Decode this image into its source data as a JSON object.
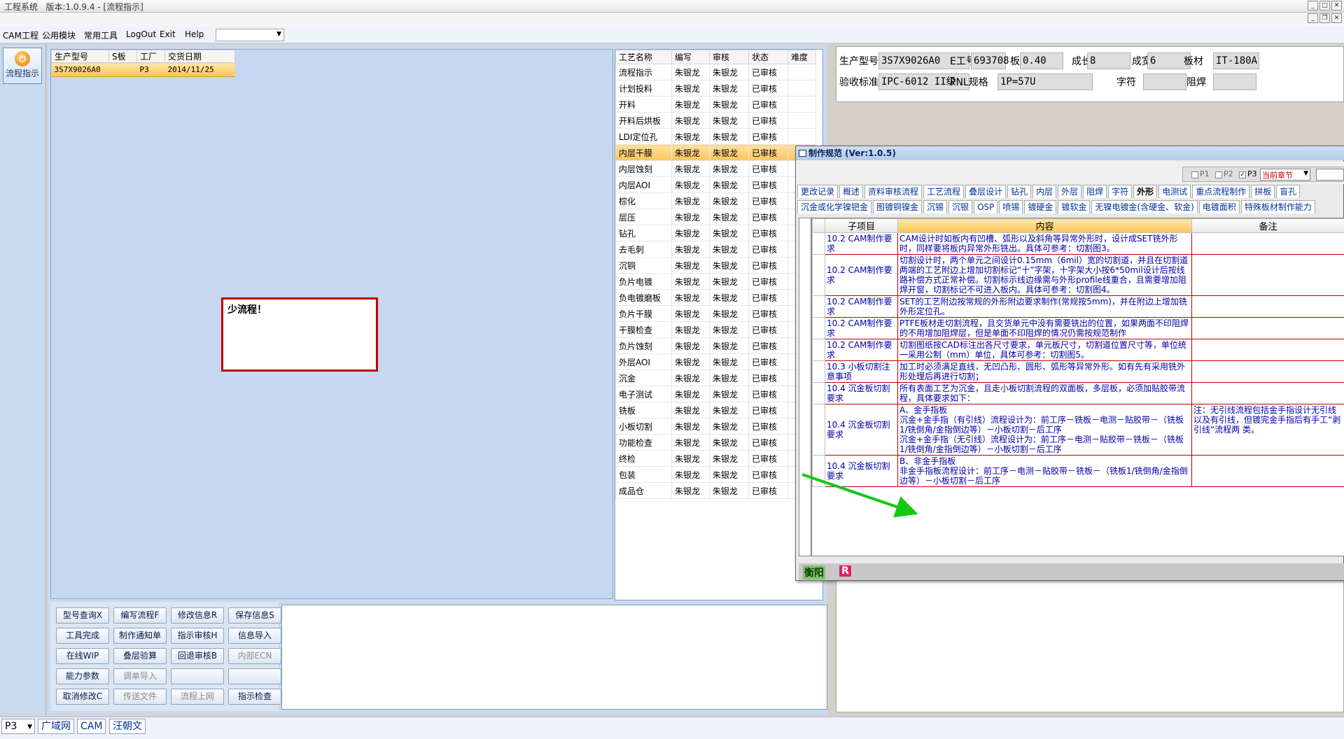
{
  "app": {
    "title": "工程系统   版本:1.0.9.4 - [流程指示]"
  },
  "menu": [
    "CAM工程",
    "公用模块",
    "常用工具",
    "LogOut",
    "Exit",
    "Help"
  ],
  "left": {
    "flow_label": "流程指示"
  },
  "prod": {
    "headers": [
      "生产型号",
      "S板",
      "工厂",
      "交货日期"
    ],
    "row": [
      "3S7X9026A0",
      "",
      "P3",
      "2014/11/25"
    ]
  },
  "message": "少流程！",
  "steps": {
    "headers": [
      "工艺名称",
      "编写",
      "审核",
      "状态",
      "难度"
    ],
    "rows": [
      [
        "流程指示",
        "朱银龙",
        "朱银龙",
        "已审核"
      ],
      [
        "计划投料",
        "朱银龙",
        "朱银龙",
        "已审核"
      ],
      [
        "开料",
        "朱银龙",
        "朱银龙",
        "已审核"
      ],
      [
        "开料后烘板",
        "朱银龙",
        "朱银龙",
        "已审核"
      ],
      [
        "LDI定位孔",
        "朱银龙",
        "朱银龙",
        "已审核"
      ],
      [
        "内层干膜",
        "朱银龙",
        "朱银龙",
        "已审核"
      ],
      [
        "内层蚀刻",
        "朱银龙",
        "朱银龙",
        "已审核"
      ],
      [
        "内层AOI",
        "朱银龙",
        "朱银龙",
        "已审核"
      ],
      [
        "棕化",
        "朱银龙",
        "朱银龙",
        "已审核"
      ],
      [
        "层压",
        "朱银龙",
        "朱银龙",
        "已审核"
      ],
      [
        "钻孔",
        "朱银龙",
        "朱银龙",
        "已审核"
      ],
      [
        "去毛刺",
        "朱银龙",
        "朱银龙",
        "已审核"
      ],
      [
        "沉铜",
        "朱银龙",
        "朱银龙",
        "已审核"
      ],
      [
        "负片电镀",
        "朱银龙",
        "朱银龙",
        "已审核"
      ],
      [
        "负电镀磨板",
        "朱银龙",
        "朱银龙",
        "已审核"
      ],
      [
        "负片干膜",
        "朱银龙",
        "朱银龙",
        "已审核"
      ],
      [
        "干膜检查",
        "朱银龙",
        "朱银龙",
        "已审核"
      ],
      [
        "负片蚀刻",
        "朱银龙",
        "朱银龙",
        "已审核"
      ],
      [
        "外层AOI",
        "朱银龙",
        "朱银龙",
        "已审核"
      ],
      [
        "沉金",
        "朱银龙",
        "朱银龙",
        "已审核"
      ],
      [
        "电子测试",
        "朱银龙",
        "朱银龙",
        "已审核"
      ],
      [
        "铣板",
        "朱银龙",
        "朱银龙",
        "已审核"
      ],
      [
        "小板切割",
        "朱银龙",
        "朱银龙",
        "已审核"
      ],
      [
        "功能检查",
        "朱银龙",
        "朱银龙",
        "已审核"
      ],
      [
        "终检",
        "朱银龙",
        "朱银龙",
        "已审核"
      ],
      [
        "包装",
        "朱银龙",
        "朱银龙",
        "已审核"
      ],
      [
        "成品仓",
        "朱银龙",
        "朱银龙",
        "已审核"
      ]
    ],
    "selected": 5
  },
  "buttons": [
    [
      "型号查询X",
      "编写流程F",
      "修改信息R",
      "保存信息S"
    ],
    [
      "工具完成",
      "制作通知单",
      "指示审核H",
      "信息导入"
    ],
    [
      "在线WIP",
      "叠层验算",
      "回退审核B",
      "内部ECN"
    ],
    [
      "能力参数",
      "调单导入",
      "",
      ""
    ],
    [
      "取消修改C",
      "传送文件",
      "流程上网",
      "指示检查"
    ]
  ],
  "info": {
    "labels": [
      "生产型号",
      "E工号",
      "板厚",
      "成长",
      "成宽",
      "板材",
      "验收标准",
      "PNL规格",
      "字符",
      "阻焊"
    ],
    "values": [
      "3S7X9026A0",
      "693708",
      "0.40",
      "8",
      "6",
      "IT-180A",
      "IPC-6012 II级",
      "1P=57U",
      "",
      ""
    ]
  },
  "spec": {
    "title": "制作规范 (Ver:1.0.5)",
    "p_labels": [
      "P1",
      "P2",
      "P3"
    ],
    "chapter": "当前章节",
    "tabs1": [
      "更改记录",
      "概述",
      "资料审核流程",
      "工艺流程",
      "叠层设计",
      "钻孔",
      "内层",
      "外层",
      "阻焊",
      "字符",
      "外形",
      "电测试",
      "重点流程制作",
      "拼板",
      "盲孔"
    ],
    "tabs2": [
      "沉金或化学镍钯金",
      "图镀铜镍金",
      "沉锡",
      "沉银",
      "OSP",
      "喷锡",
      "镀硬金",
      "镀软金",
      "无镍电镀金(含硬金、软金)",
      "电镀面积",
      "特殊板材制作能力"
    ],
    "headers": [
      "子项目",
      "内容",
      "备注"
    ],
    "rows": [
      [
        "10.2 CAM制作要求",
        "CAM设计时如板内有凹槽、弧形以及斜角等异常外形时，设计成SET铣外形时，同样要将板内异常外形铣出。具体可参考：切割图3。",
        ""
      ],
      [
        "10.2 CAM制作要求",
        "切割设计时，两个单元之间设计0.15mm（6mil）宽的切割道，并且在切割道两端的工艺附边上增加切割标记“十”字架，十字架大小按6*50mil设计后按线路补偿方式正常补偿。切割标示线边缘需与外形profile线重合，且需要增加阻焊开窗，切割标记不可进入板内。具体可参考：切割图4。",
        ""
      ],
      [
        "10.2 CAM制作要求",
        "SET的工艺附边按常规的外形附边要求制作(常规按5mm)，并在附边上增加铣外形定位孔。",
        ""
      ],
      [
        "10.2 CAM制作要求",
        "PTFE板材走切割流程，且交货单元中没有需要铣出的位置，如果两面不印阻焊的不用增加阻焊层，但是单面不印阻焊的情况仍需按规范制作",
        ""
      ],
      [
        "10.2 CAM制作要求",
        "切割图纸按CAD标注出各尺寸要求，单元板尺寸，切割道位置尺寸等，单位统一采用公制（mm）单位，具体可参考：切割图5。",
        ""
      ],
      [
        "10.3 小板切割注意事项",
        "加工时必须满足直线，无凹凸形、圆形、弧形等异常外形。如有先有采用铣外形处理后再进行切割；",
        ""
      ],
      [
        "10.4 沉金板切割要求",
        "所有表面工艺为沉金，且走小板切割流程的双面板，多层板，必须加贴胶带流程，具体要求如下：",
        ""
      ],
      [
        "10.4 沉金板切割要求",
        "A、金手指板\n沉金+金手指（有引线）流程设计为：前工序－铣板－电测－贴胶带－（铣板1/铣倒角/金指倒边等）－小板切割－后工序\n沉金+金手指（无引线）流程设计为：前工序－电测－贴胶带－铣板－（铣板1/铣倒角/金指倒边等）－小板切割－后工序",
        "注：无引线流程包括金手指设计无引线以及有引线，但镀完金手指后有手工“剥引线“流程两 类。"
      ],
      [
        "10.4 沉金板切割要求",
        "B、非金手指板\n非金手指板流程设计：前工序－电测－贴胶带－铣板－（铣板1/铣倒角/金指倒边等）－小板切割－后工序",
        ""
      ]
    ],
    "status": [
      "衡阳",
      "R"
    ]
  },
  "taskbar": {
    "combo": "P3",
    "items": [
      "广域网",
      "CAM",
      "汪朝文"
    ]
  }
}
